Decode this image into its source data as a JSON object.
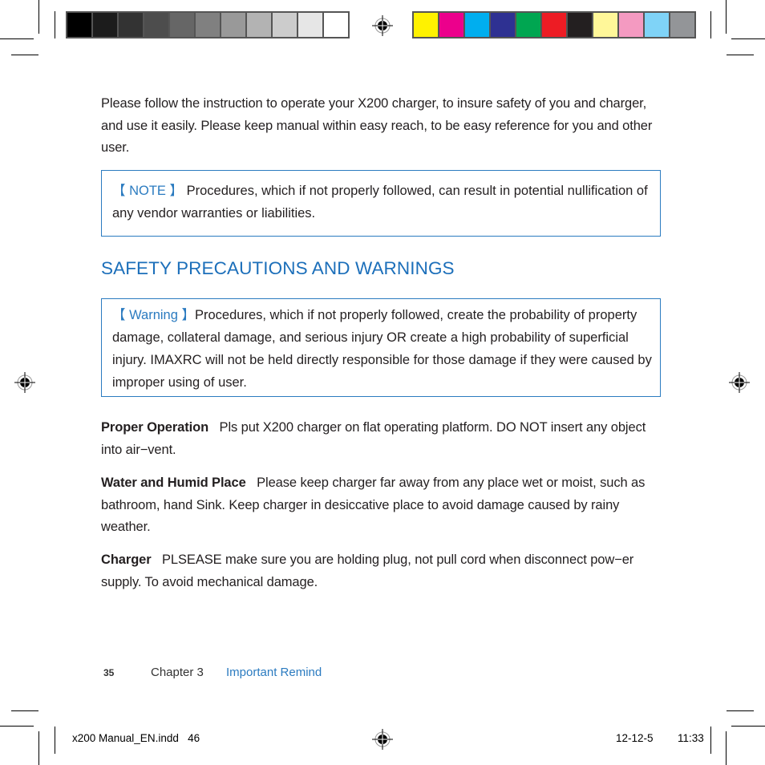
{
  "print_marks": {
    "grayscale_swatches": [
      "#000000",
      "#1c1c1c",
      "#333333",
      "#4d4d4d",
      "#666666",
      "#808080",
      "#999999",
      "#b3b3b3",
      "#cccccc",
      "#e6e6e6",
      "#ffffff"
    ],
    "color_swatches": [
      "#fff200",
      "#ec008c",
      "#00aeef",
      "#2e3192",
      "#00a651",
      "#ed1c24",
      "#231f20",
      "#fff799",
      "#f49ac1",
      "#7fd3f7",
      "#939598"
    ]
  },
  "intro": "Please follow the instruction to operate your X200 charger, to insure safety of you and charger, and use it easily. Please keep manual within easy reach, to be easy reference for you and other user.",
  "note": {
    "tag": "【 NOTE 】",
    "text": " Procedures, which if not properly followed, can result in potential nullification of any vendor warranties or liabilities."
  },
  "section_title": "SAFETY PRECAUTIONS AND WARNINGS",
  "warning": {
    "tag": "【 Warning 】",
    "text": "Procedures, which if not properly followed, create the probability of property damage, collateral damage, and serious injury OR create a high probability of superficial injury. IMAXRC will not be held directly responsible for those damage if they were caused by improper using of user."
  },
  "items": [
    {
      "term": "Proper Operation",
      "text": "Pls put X200 charger on flat operating platform. DO NOT insert any object into air−vent."
    },
    {
      "term": "Water and Humid Place",
      "text": "Please keep charger far away from any place wet or moist, such as bathroom, hand Sink. Keep charger in desiccative place to avoid damage caused by rainy weather."
    },
    {
      "term": "Charger",
      "text": "PLSEASE make sure you are holding plug, not pull cord when disconnect pow−er supply. To avoid mechanical damage."
    }
  ],
  "footer": {
    "page_number": "35",
    "chapter": "Chapter 3",
    "section": "Important Remind"
  },
  "slug": {
    "file": "x200 Manual_EN.indd   46",
    "date": "12-12-5",
    "time": "11:33"
  }
}
